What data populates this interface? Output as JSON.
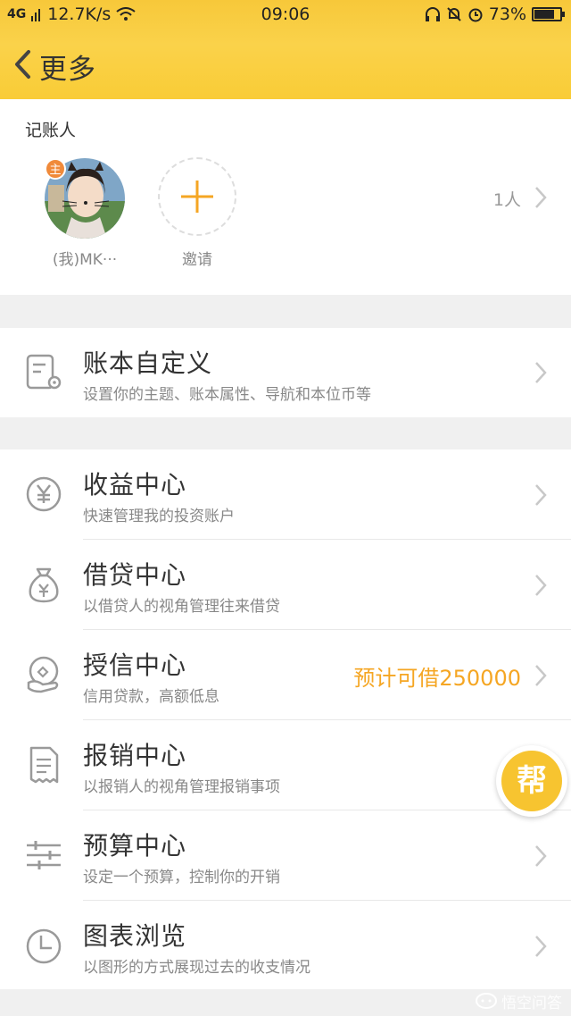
{
  "status": {
    "net": "4G",
    "speed": "12.7K/s",
    "time": "09:06",
    "battery": "73%"
  },
  "nav": {
    "title": "更多"
  },
  "recorders": {
    "label": "记账人",
    "owner_badge": "主",
    "me_name": "(我)MK···",
    "invite_label": "邀请",
    "count": "1人"
  },
  "custom": {
    "title": "账本自定义",
    "sub": "设置你的主题、账本属性、导航和本位币等"
  },
  "centers": [
    {
      "title": "收益中心",
      "sub": "快速管理我的投资账户",
      "promo": ""
    },
    {
      "title": "借贷中心",
      "sub": "以借贷人的视角管理往来借贷",
      "promo": ""
    },
    {
      "title": "授信中心",
      "sub": "信用贷款，高额低息",
      "promo": "预计可借250000"
    },
    {
      "title": "报销中心",
      "sub": "以报销人的视角管理报销事项",
      "promo": ""
    },
    {
      "title": "预算中心",
      "sub": "设定一个预算，控制你的开销",
      "promo": ""
    },
    {
      "title": "图表浏览",
      "sub": "以图形的方式展现过去的收支情况",
      "promo": ""
    }
  ],
  "help": {
    "label": "帮"
  },
  "watermark": "悟空问答",
  "colors": {
    "header": "#f9cc36",
    "accent": "#f5a623",
    "icon": "#9a9a9a"
  }
}
